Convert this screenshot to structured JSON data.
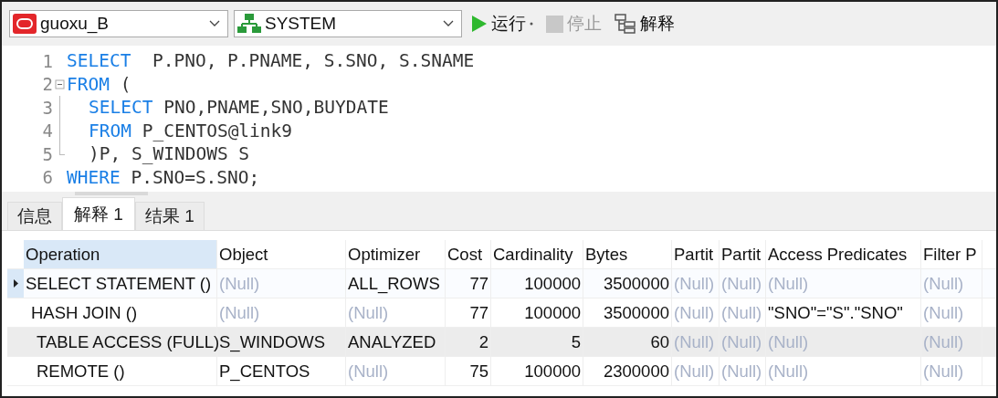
{
  "toolbar": {
    "connection": "guoxu_B",
    "schema": "SYSTEM",
    "buttons": [
      {
        "kind": "run",
        "label": "运行",
        "disabled": false
      },
      {
        "kind": "stop",
        "label": "停止",
        "disabled": true
      },
      {
        "kind": "explain",
        "label": "解释",
        "disabled": false
      }
    ]
  },
  "editor": {
    "lines": [
      {
        "number": "1",
        "segments": [
          {
            "kind": "keyword",
            "text": "SELECT"
          },
          {
            "kind": "plain",
            "text": "  P.PNO, P.PNAME, S.SNO, S.SNAME"
          }
        ]
      },
      {
        "number": "2",
        "expanded": true,
        "segments": [
          {
            "kind": "keyword",
            "text": "FROM"
          },
          {
            "kind": "plain",
            "text": " ("
          }
        ],
        "children": [
          {
            "number": "3",
            "segments": [
              {
                "kind": "keyword",
                "text": "SELECT"
              },
              {
                "kind": "plain",
                "text": " PNO,PNAME,SNO,BUYDATE"
              }
            ]
          },
          {
            "number": "4",
            "segments": [
              {
                "kind": "keyword",
                "text": "FROM"
              },
              {
                "kind": "plain",
                "text": " P_CENTOS@link9"
              }
            ]
          },
          {
            "number": "5",
            "segments": [
              {
                "kind": "plain",
                "text": ")P, S_WINDOWS S"
              }
            ]
          }
        ]
      },
      {
        "number": "6",
        "segments": [
          {
            "kind": "keyword",
            "text": "WHERE"
          },
          {
            "kind": "plain",
            "text": " P.SNO=S.SNO;"
          }
        ]
      }
    ]
  },
  "tabs": [
    {
      "label": "信息",
      "selected": false
    },
    {
      "label": "解释 1",
      "selected": true
    },
    {
      "label": "结果 1",
      "selected": false
    }
  ],
  "table": {
    "columns": [
      {
        "label": "Operation",
        "kind": "text",
        "selected": true
      },
      {
        "label": "Object",
        "kind": "text",
        "selected": false
      },
      {
        "label": "Optimizer",
        "kind": "text",
        "selected": false
      },
      {
        "label": "Cost",
        "kind": "number",
        "selected": false
      },
      {
        "label": "Cardinality",
        "kind": "number",
        "selected": false
      },
      {
        "label": "Bytes",
        "kind": "number",
        "selected": false
      },
      {
        "label": "Partit",
        "kind": "text",
        "selected": false
      },
      {
        "label": "Partit",
        "kind": "text",
        "selected": false
      },
      {
        "label": "Access Predicates",
        "kind": "text",
        "selected": false
      },
      {
        "label": "Filter P",
        "kind": "text",
        "selected": false
      }
    ],
    "rows": [
      {
        "selected": true,
        "highlighted": false,
        "cells": [
          {
            "text": "SELECT STATEMENT ()",
            "null": false
          },
          {
            "text": "(Null)",
            "null": true
          },
          {
            "text": "ALL_ROWS",
            "null": false
          },
          {
            "text": "77",
            "null": false
          },
          {
            "text": "100000",
            "null": false
          },
          {
            "text": "3500000",
            "null": false
          },
          {
            "text": "(Null)",
            "null": true
          },
          {
            "text": "(Null)",
            "null": true
          },
          {
            "text": "(Null)",
            "null": true
          },
          {
            "text": "(Null)",
            "null": true
          }
        ],
        "children": [
          {
            "selected": false,
            "highlighted": false,
            "cells": [
              {
                "text": "HASH JOIN ()",
                "null": false
              },
              {
                "text": "(Null)",
                "null": true
              },
              {
                "text": "(Null)",
                "null": true
              },
              {
                "text": "77",
                "null": false
              },
              {
                "text": "100000",
                "null": false
              },
              {
                "text": "3500000",
                "null": false
              },
              {
                "text": "(Null)",
                "null": true
              },
              {
                "text": "(Null)",
                "null": true
              },
              {
                "text": "\"SNO\"=\"S\".\"SNO\"",
                "null": false
              },
              {
                "text": "(Null)",
                "null": true
              }
            ],
            "children": [
              {
                "selected": false,
                "highlighted": true,
                "cells": [
                  {
                    "text": "TABLE ACCESS (FULL)",
                    "null": false
                  },
                  {
                    "text": "S_WINDOWS",
                    "null": false
                  },
                  {
                    "text": "ANALYZED",
                    "null": false
                  },
                  {
                    "text": "2",
                    "null": false
                  },
                  {
                    "text": "5",
                    "null": false
                  },
                  {
                    "text": "60",
                    "null": false
                  },
                  {
                    "text": "(Null)",
                    "null": true
                  },
                  {
                    "text": "(Null)",
                    "null": true
                  },
                  {
                    "text": "(Null)",
                    "null": true
                  },
                  {
                    "text": "(Null)",
                    "null": true
                  }
                ]
              },
              {
                "selected": false,
                "highlighted": false,
                "cells": [
                  {
                    "text": "REMOTE ()",
                    "null": false
                  },
                  {
                    "text": "P_CENTOS",
                    "null": false
                  },
                  {
                    "text": "(Null)",
                    "null": true
                  },
                  {
                    "text": "75",
                    "null": false
                  },
                  {
                    "text": "100000",
                    "null": false
                  },
                  {
                    "text": "2300000",
                    "null": false
                  },
                  {
                    "text": "(Null)",
                    "null": true
                  },
                  {
                    "text": "(Null)",
                    "null": true
                  },
                  {
                    "text": "(Null)",
                    "null": true
                  },
                  {
                    "text": "(Null)",
                    "null": true
                  }
                ]
              }
            ]
          }
        ]
      }
    ]
  }
}
